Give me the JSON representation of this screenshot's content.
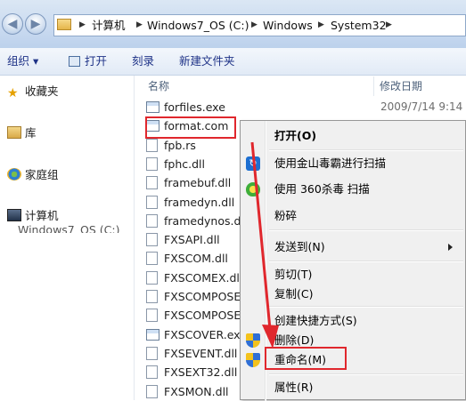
{
  "address": {
    "crumbs": [
      "计算机",
      "Windows7_OS (C:)",
      "Windows",
      "System32"
    ]
  },
  "toolbar": {
    "organize": "组织 ▾",
    "open": "打开",
    "burn": "刻录",
    "new_folder": "新建文件夹"
  },
  "nav": {
    "favorites": "收藏夹",
    "libraries": "库",
    "homegroup": "家庭组",
    "computer": "计算机",
    "drive": "Windows7_OS (C:)"
  },
  "list": {
    "col_name": "名称",
    "col_date": "修改日期",
    "files": [
      {
        "name": "forfiles.exe",
        "date": "2009/7/14 9:14",
        "icon": "exe-icon"
      },
      {
        "name": "format.com",
        "date": "",
        "icon": "exe-icon"
      },
      {
        "name": "fpb.rs",
        "date": "",
        "icon": "file-icon"
      },
      {
        "name": "fphc.dll",
        "date": "",
        "icon": "dll-icon"
      },
      {
        "name": "framebuf.dll",
        "date": "",
        "icon": "dll-icon"
      },
      {
        "name": "framedyn.dll",
        "date": "",
        "icon": "dll-icon"
      },
      {
        "name": "framedynos.dll",
        "date": "",
        "icon": "dll-icon"
      },
      {
        "name": "FXSAPI.dll",
        "date": "",
        "icon": "dll-icon"
      },
      {
        "name": "FXSCOM.dll",
        "date": "",
        "icon": "dll-icon"
      },
      {
        "name": "FXSCOMEX.dll",
        "date": "",
        "icon": "dll-icon"
      },
      {
        "name": "FXSCOMPOSE",
        "date": "",
        "icon": "dll-icon"
      },
      {
        "name": "FXSCOMPOSE",
        "date": "",
        "icon": "dll-icon"
      },
      {
        "name": "FXSCOVER.exe",
        "date": "",
        "icon": "exe-icon"
      },
      {
        "name": "FXSEVENT.dll",
        "date": "",
        "icon": "dll-icon"
      },
      {
        "name": "FXSEXT32.dll",
        "date": "",
        "icon": "dll-icon"
      },
      {
        "name": "FXSMON.dll",
        "date": "",
        "icon": "dll-icon"
      }
    ]
  },
  "menu": {
    "items": [
      {
        "label": "打开(O)",
        "bold": true
      },
      {
        "label": "使用金山毒霸进行扫描"
      },
      {
        "label": "使用 360杀毒 扫描"
      },
      {
        "label": "粉碎"
      },
      {
        "label": "发送到(N)"
      },
      {
        "label": "剪切(T)"
      },
      {
        "label": "复制(C)"
      },
      {
        "label": "创建快捷方式(S)"
      },
      {
        "label": "删除(D)"
      },
      {
        "label": "重命名(M)"
      },
      {
        "label": "属性(R)"
      }
    ]
  },
  "colors": {
    "highlight": "#e0272d",
    "accent": "#1e3287"
  }
}
